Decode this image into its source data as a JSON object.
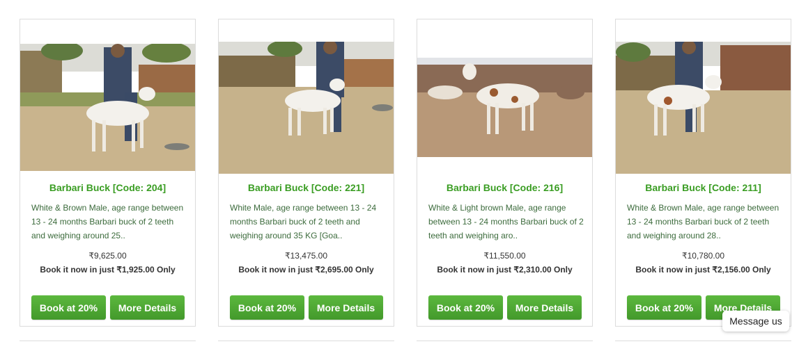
{
  "products": [
    {
      "title": "Barbari Buck [Code: 204]",
      "description": "White & Brown Male, age range between 13 - 24 months Barbari buck of 2 teeth and weighing around 25..",
      "price": "₹9,625.00",
      "booking": "Book it now in just ₹1,925.00 Only",
      "book_button": "Book at 20%",
      "details_button": "More Details"
    },
    {
      "title": "Barbari Buck [Code: 221]",
      "description": "White Male, age range between 13 - 24 months Barbari buck of 2 teeth and weighing around 35 KG [Goa..",
      "price": "₹13,475.00",
      "booking": "Book it now in just ₹2,695.00 Only",
      "book_button": "Book at 20%",
      "details_button": "More Details"
    },
    {
      "title": "Barbari Buck [Code: 216]",
      "description": "White & Light brown Male, age range between 13 - 24 months Barbari buck of 2 teeth and weighing aro..",
      "price": "₹11,550.00",
      "booking": "Book it now in just ₹2,310.00 Only",
      "book_button": "Book at 20%",
      "details_button": "More Details"
    },
    {
      "title": "Barbari Buck [Code: 211]",
      "description": "White & Brown Male, age range between 13 - 24 months Barbari buck of 2 teeth and weighing around 28..",
      "price": "₹10,780.00",
      "booking": "Book it now in just ₹2,156.00 Only",
      "book_button": "Book at 20%",
      "details_button": "More Details"
    }
  ],
  "chat": {
    "label": "Message us"
  },
  "colors": {
    "accent": "#3a9d23",
    "button": "#4ea832"
  }
}
